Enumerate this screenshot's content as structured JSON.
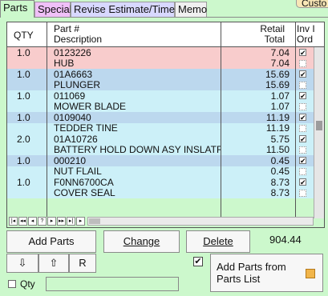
{
  "tabs": [
    {
      "label": "Parts",
      "active": true
    },
    {
      "label": "Special",
      "active": false
    },
    {
      "label": "Revise Estimate/Times",
      "active": false
    },
    {
      "label": "Memo",
      "active": false
    }
  ],
  "custom_button": "Custo",
  "grid": {
    "headers": {
      "qty": "QTY",
      "part_number": "Part #",
      "description": "Description",
      "retail": "Retail",
      "total": "Total",
      "inv": "Inv I",
      "ord": "Ord"
    },
    "rows": [
      {
        "qty": "1.0",
        "part": "0123226",
        "desc": "HUB",
        "retail": "7.04",
        "total": "7.04",
        "inv": true,
        "color_top": "#f8cccc",
        "color_bottom": "#f8cccc"
      },
      {
        "qty": "1.0",
        "part": "01A6663",
        "desc": "PLUNGER",
        "retail": "15.69",
        "total": "15.69",
        "inv": true,
        "color_top": "#bcd8ee",
        "color_bottom": "#bcd8ee"
      },
      {
        "qty": "1.0",
        "part": "011069",
        "desc": "MOWER BLADE",
        "retail": "1.07",
        "total": "1.07",
        "inv": true,
        "color_top": "#ccf0f8",
        "color_bottom": "#ccf0f8"
      },
      {
        "qty": "1.0",
        "part": "0109040",
        "desc": "TEDDER TINE",
        "retail": "11.19",
        "total": "11.19",
        "inv": true,
        "color_top": "#bcd8ee",
        "color_bottom": "#ccf0f8"
      },
      {
        "qty": "2.0",
        "part": "01A10726",
        "desc": "BATTERY HOLD DOWN ASY INSLATR",
        "retail": "5.75",
        "total": "11.50",
        "inv": true,
        "color_top": "#ccf0f8",
        "color_bottom": "#ccf0f8"
      },
      {
        "qty": "1.0",
        "part": "000210",
        "desc": "NUT FLAIL",
        "retail": "0.45",
        "total": "0.45",
        "inv": true,
        "color_top": "#bcd8ee",
        "color_bottom": "#ccf0f8"
      },
      {
        "qty": "1.0",
        "part": "F0NN6700CA",
        "desc": "COVER SEAL",
        "retail": "8.73",
        "total": "8.73",
        "inv": true,
        "color_top": "#ccf0f8",
        "color_bottom": "#ccf0f8"
      }
    ],
    "nav_buttons": [
      "|◂",
      "◂◂",
      "◂",
      "?",
      "▸",
      "▸▸",
      "▸|",
      "▸"
    ]
  },
  "buttons": {
    "add_parts": "Add Parts",
    "change": "Change",
    "delete": "Delete",
    "move_down": "⇩",
    "move_up": "⇧",
    "r": "R",
    "add_parts_from_list_line1": "Add Parts from",
    "add_parts_from_list_line2": "Parts List"
  },
  "total_value": "904.44",
  "qty_label": "Qty",
  "checkbox_mark": "✔",
  "inv_mark": "✔",
  "ord_mark": "⠀"
}
